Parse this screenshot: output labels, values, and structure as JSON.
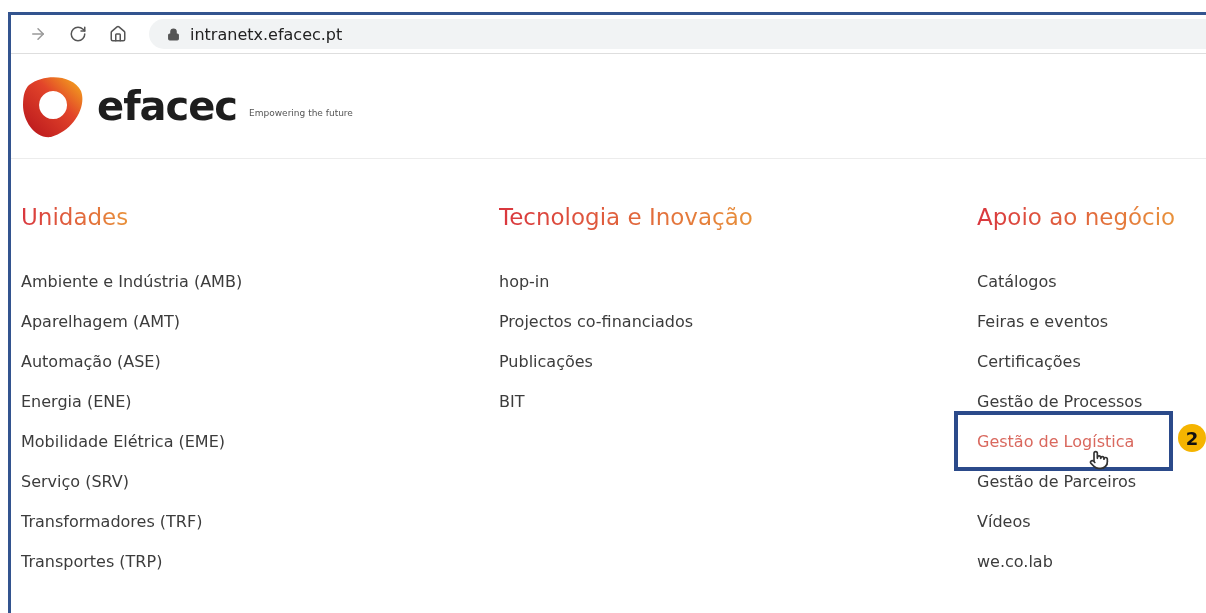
{
  "browser": {
    "url": "intranetx.efacec.pt"
  },
  "header": {
    "logo_text": "efacec",
    "tagline": "Empowering the future"
  },
  "columns": [
    {
      "heading": "Unidades",
      "links": [
        {
          "label": "Ambiente e Indústria (AMB)",
          "selected": false
        },
        {
          "label": "Aparelhagem (AMT)",
          "selected": false
        },
        {
          "label": "Automação (ASE)",
          "selected": false
        },
        {
          "label": "Energia (ENE)",
          "selected": false
        },
        {
          "label": "Mobilidade Elétrica (EME)",
          "selected": false
        },
        {
          "label": "Serviço (SRV)",
          "selected": false
        },
        {
          "label": "Transformadores (TRF)",
          "selected": false
        },
        {
          "label": "Transportes (TRP)",
          "selected": false
        }
      ]
    },
    {
      "heading": "Tecnologia e Inovação",
      "links": [
        {
          "label": "hop-in",
          "selected": false
        },
        {
          "label": "Projectos co-financiados",
          "selected": false
        },
        {
          "label": "Publicações",
          "selected": false
        },
        {
          "label": "BIT",
          "selected": false
        }
      ]
    },
    {
      "heading": "Apoio ao negócio",
      "links": [
        {
          "label": "Catálogos",
          "selected": false
        },
        {
          "label": "Feiras e eventos",
          "selected": false
        },
        {
          "label": "Certificações",
          "selected": false
        },
        {
          "label": "Gestão de Processos",
          "selected": false
        },
        {
          "label": "Gestão de Logística",
          "selected": true
        },
        {
          "label": "Gestão de Parceiros",
          "selected": false
        },
        {
          "label": "Vídeos",
          "selected": false
        },
        {
          "label": "we.co.lab",
          "selected": false
        }
      ]
    }
  ],
  "annotation": {
    "badge": "2"
  }
}
